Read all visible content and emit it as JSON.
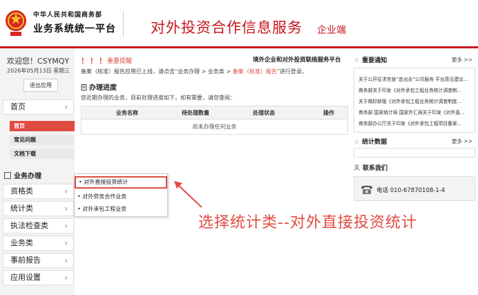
{
  "header": {
    "ministry": "中华人民共和国商务部",
    "platform": "业务系统统一平台",
    "title": "对外投资合作信息服务",
    "subtitle": "企业端"
  },
  "user": {
    "welcome": "欢迎您！CSYMQY",
    "date": "2026年05月13日 星期三",
    "logout": "退出应用"
  },
  "sidebar": {
    "home": "首页",
    "home_sub": [
      "首页",
      "常见问题",
      "文档下载"
    ],
    "section": "业务办理",
    "items": [
      "资格类",
      "统计类",
      "执法检查类",
      "业务类",
      "事前报告",
      "应用设置"
    ],
    "chevron": "›"
  },
  "notice": {
    "marks": "！！！",
    "title": "重要提醒",
    "banner": "境外企业和对外投资联络服务平台",
    "text_prefix": "备案（核准）报告应用已上线，请点击“业务办理 > 业务类 > ",
    "text_highlight": "备案（核准）报告",
    "text_suffix": "”进行登录。"
  },
  "progress": {
    "title": "办理进度",
    "desc": "您近期办理的业务，目前处理进度如下，如有需要，请您查阅：",
    "columns": [
      "业务名称",
      "待处理数量",
      "处理状态",
      "操作"
    ],
    "empty": "尚未办理任何业务"
  },
  "dropdown": {
    "items": [
      "对外直接投资统计",
      "对外劳务合作业务",
      "对外承包工程业务"
    ],
    "bullet": "•"
  },
  "annotation": "选择统计类--对外直接投资统计",
  "right": {
    "notice_title": "重要通知",
    "more": "更多 >>",
    "notices": [
      "关于公开征求完善“走出去”公共服务 平台意见建议...",
      "商务部关于印发《对外承包工程业务统计调查制...",
      "关于做好新版《对外承包工程业务统计调查制度...",
      "商务部 国家统计局 国家外汇局关于印发《对外直...",
      "商务部办公厅关于印发《对外承包工程项目备案..."
    ],
    "stats_title": "统计数据",
    "contact_title": "联系我们",
    "phone": "电话 010-67870108-1-4"
  },
  "colors": {
    "brand_red": "#c8161d",
    "accent_red": "#e04b41"
  }
}
